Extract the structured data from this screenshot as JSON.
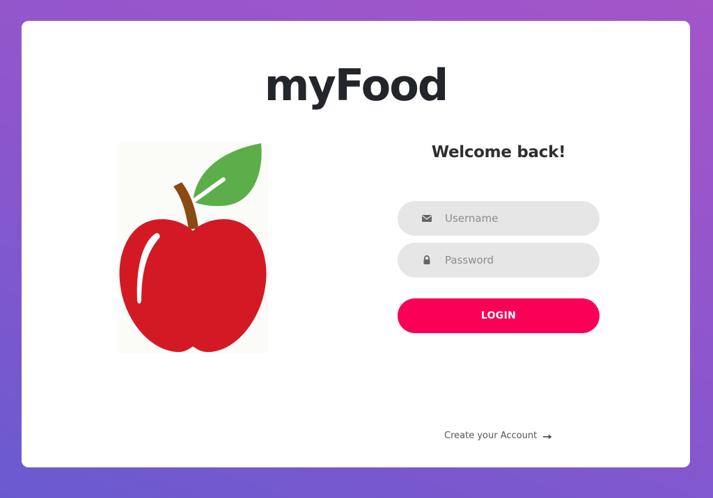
{
  "app": {
    "brand": "myFood"
  },
  "login": {
    "heading": "Welcome back!",
    "username": {
      "placeholder": "Username",
      "value": "",
      "icon": "envelope-icon"
    },
    "password": {
      "placeholder": "Password",
      "value": "",
      "icon": "lock-icon"
    },
    "submit_label": "LOGIN",
    "create_account_label": "Create your Account",
    "create_account_icon": "arrow-right-icon"
  },
  "illustration": {
    "subject": "apple-illustration"
  },
  "colors": {
    "background_gradient": [
      "#6a5ad0",
      "#a455c8"
    ],
    "card": "#ffffff",
    "input_bg": "#e6e6e6",
    "primary_button": "#f90157",
    "heading_text": "#2f2f2f",
    "apple_red": "#d31a24",
    "leaf_green": "#5cae4a",
    "stem_brown": "#8a4a12"
  }
}
